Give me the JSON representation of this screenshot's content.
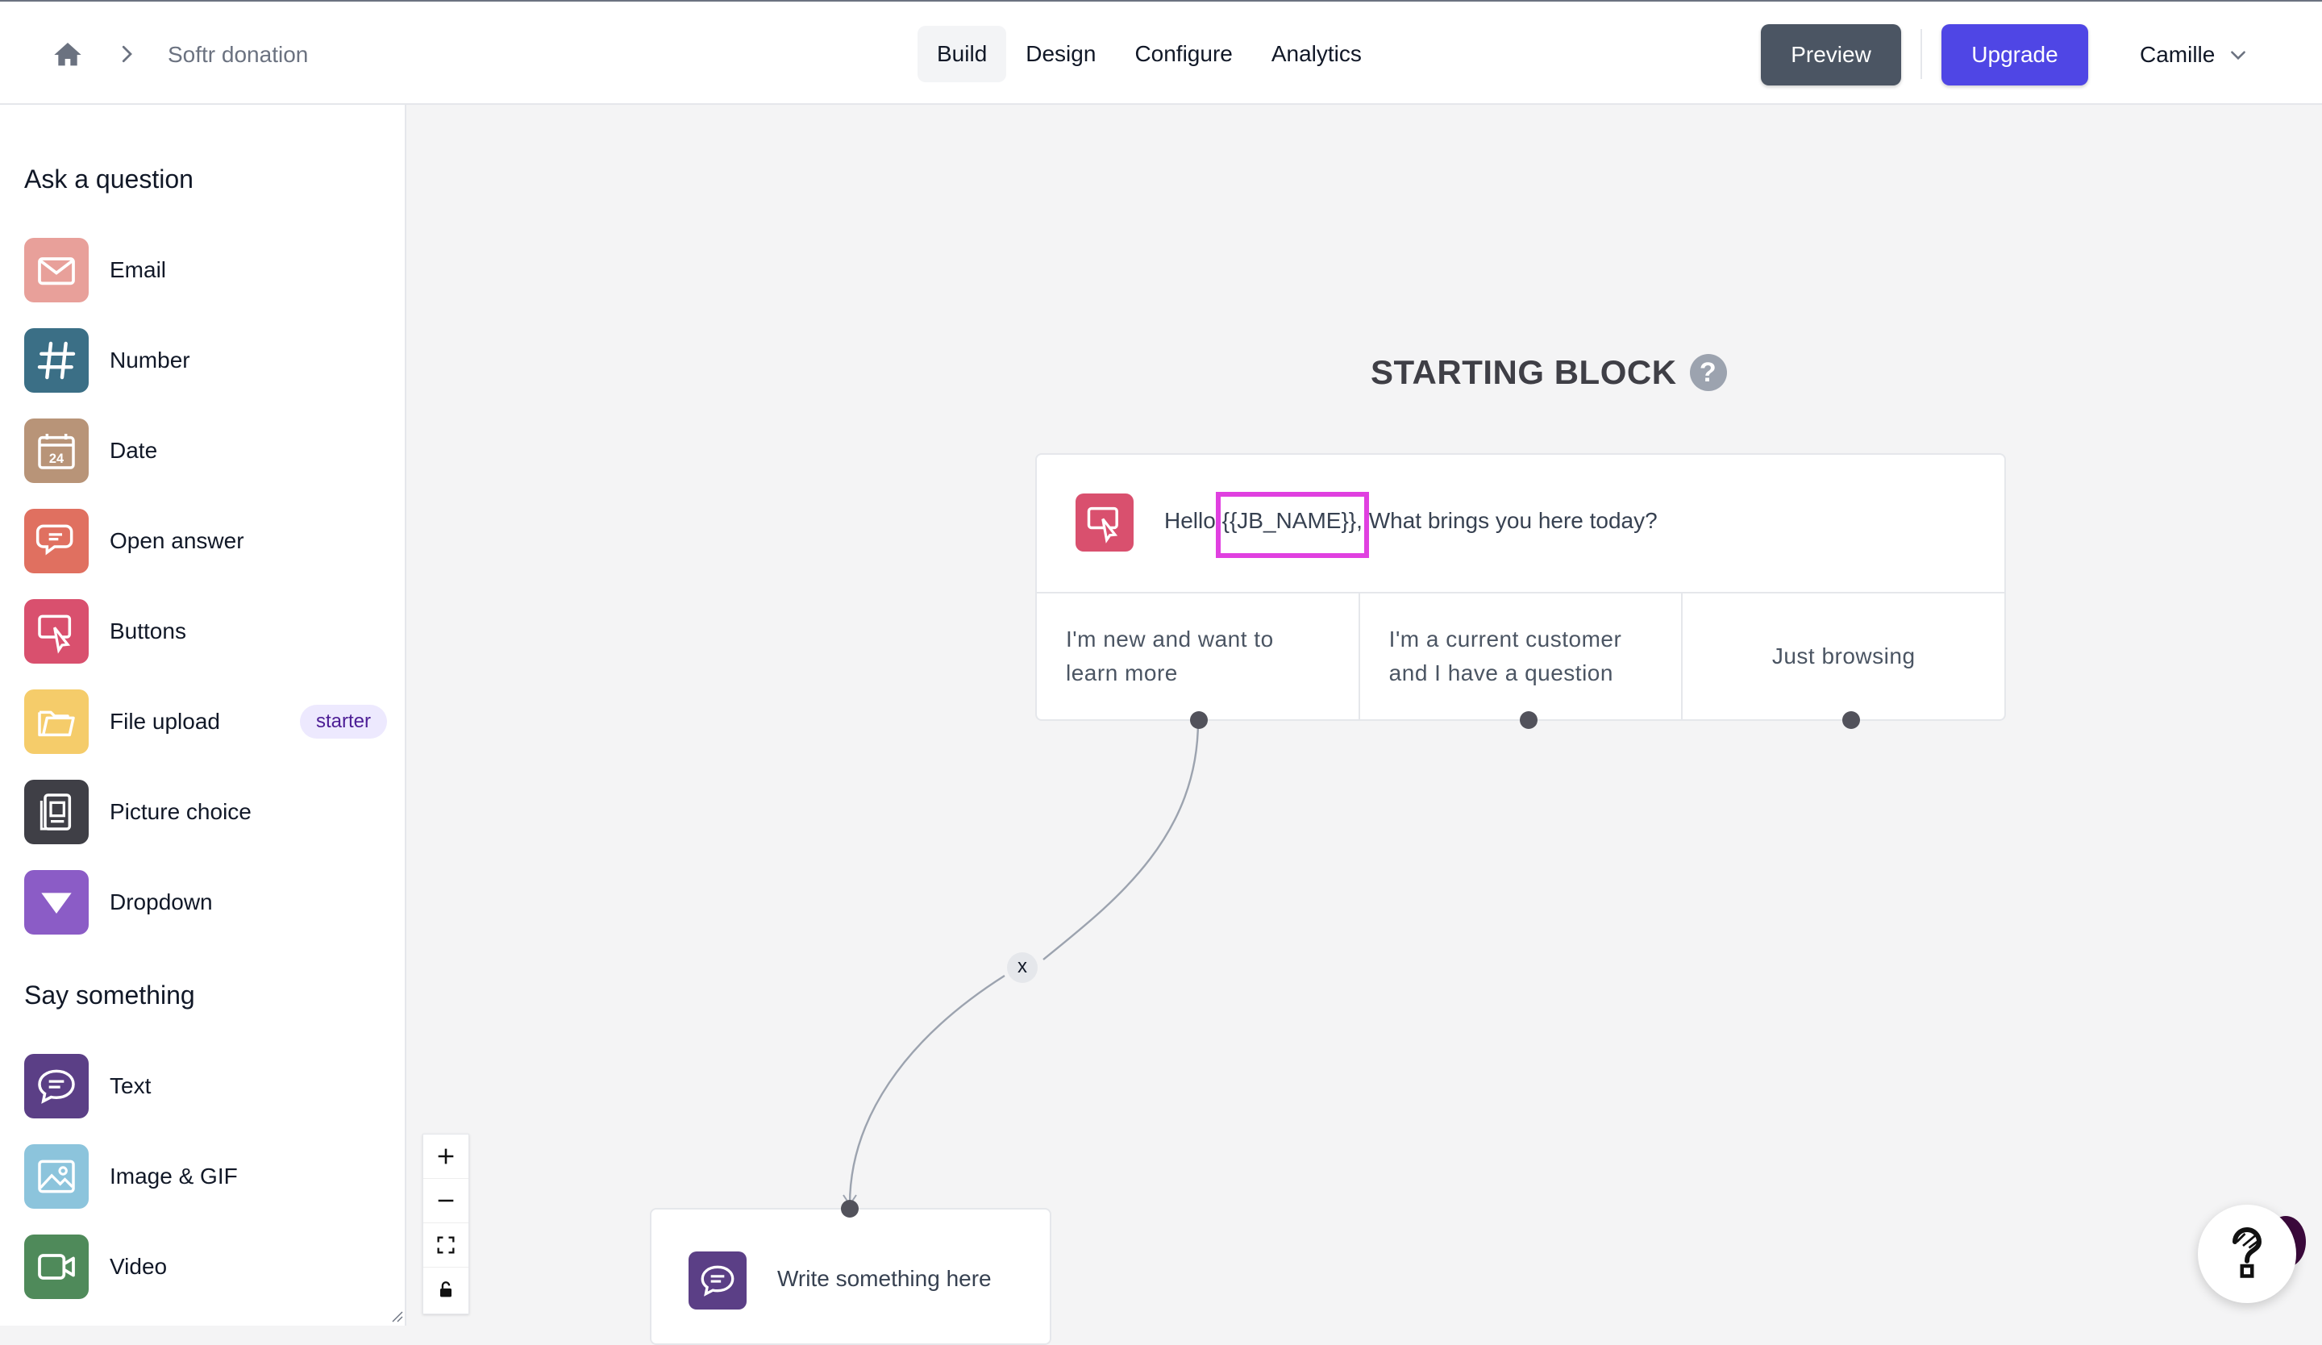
{
  "breadcrumb": {
    "home_icon": "home-icon",
    "title": "Softr donation"
  },
  "nav": {
    "tabs": [
      {
        "label": "Build",
        "active": true
      },
      {
        "label": "Design"
      },
      {
        "label": "Configure"
      },
      {
        "label": "Analytics"
      }
    ]
  },
  "header": {
    "preview_label": "Preview",
    "upgrade_label": "Upgrade",
    "user_name": "Camille",
    "colors": {
      "preview": "#4b5563",
      "upgrade": "#4f46e5"
    }
  },
  "sidebar": {
    "ask_title": "Ask a question",
    "ask_items": [
      {
        "label": "Email",
        "icon": "email-icon",
        "color": "#e8a09a"
      },
      {
        "label": "Number",
        "icon": "hash-icon",
        "color": "#3b6f86"
      },
      {
        "label": "Date",
        "icon": "calendar-icon",
        "color": "#b89478"
      },
      {
        "label": "Open answer",
        "icon": "chat-bubbles-icon",
        "color": "#e07060"
      },
      {
        "label": "Buttons",
        "icon": "cursor-click-icon",
        "color": "#d9506e"
      },
      {
        "label": "File upload",
        "icon": "folder-icon",
        "color": "#f5cc6a",
        "badge": "starter"
      },
      {
        "label": "Picture choice",
        "icon": "picture-choice-icon",
        "color": "#3f3f46"
      },
      {
        "label": "Dropdown",
        "icon": "dropdown-icon",
        "color": "#8b5cc6"
      }
    ],
    "say_title": "Say something",
    "say_items": [
      {
        "label": "Text",
        "icon": "speech-bubble-icon",
        "color": "#5b3f86"
      },
      {
        "label": "Image & GIF",
        "icon": "image-icon",
        "color": "#8cc4dc"
      },
      {
        "label": "Video",
        "icon": "video-camera-icon",
        "color": "#4f8a5a"
      }
    ]
  },
  "canvas": {
    "starting_title": "STARTING BLOCK",
    "help_glyph": "?",
    "start_block": {
      "message_prefix": "Hello ",
      "variable": "{{JB_NAME}},",
      "message_suffix": " What brings you here today?",
      "choices": [
        "I'm new and want to learn more",
        "I'm a current customer and I have a question",
        "Just browsing"
      ]
    },
    "remove_link_label": "x",
    "text_block": {
      "label": "Write something here"
    }
  },
  "zoom_controls": [
    "zoom-in-icon",
    "zoom-out-icon",
    "fit-view-icon",
    "lock-icon"
  ],
  "highlight_color": "#e040e0"
}
